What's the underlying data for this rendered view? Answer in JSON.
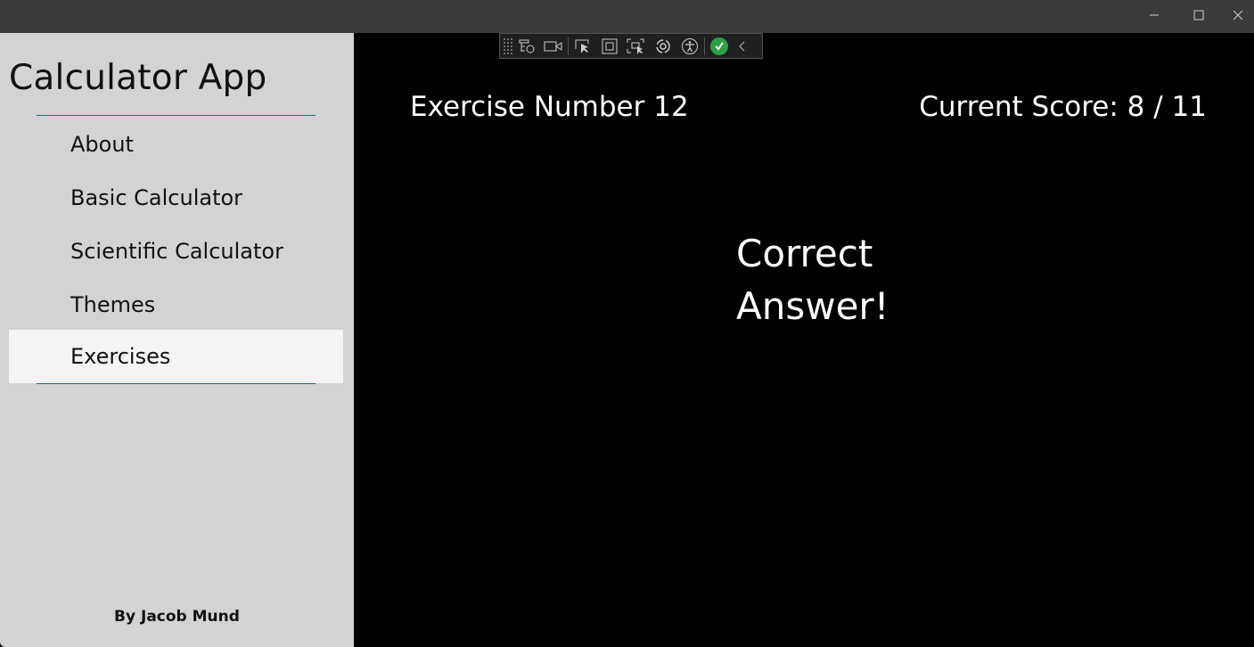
{
  "sidebar": {
    "app_title": "Calculator App",
    "nav_items": [
      {
        "label": "About"
      },
      {
        "label": "Basic Calculator"
      },
      {
        "label": "Scientific Calculator"
      },
      {
        "label": "Themes"
      },
      {
        "label": "Exercises",
        "selected": true
      }
    ],
    "footer": "By Jacob Mund"
  },
  "main": {
    "exercise_number": "Exercise Number 12",
    "score": "Current Score: 8 / 11",
    "result": "Correct Answer!"
  },
  "debug_toolbar": {
    "icons": [
      "live-visual-tree-icon",
      "record-icon",
      "select-element-icon",
      "display-layout-adorners-icon",
      "track-focus-icon",
      "hot-reload-icon",
      "accessibility-icon",
      "check-icon",
      "collapse-chevron-icon"
    ]
  },
  "colors": {
    "sidebar_bg": "#d3d3d3",
    "selected_bg": "#f4f4f4",
    "divider": "#1a6e84",
    "main_bg": "#000000",
    "titlebar_bg": "#3a3a3a"
  }
}
